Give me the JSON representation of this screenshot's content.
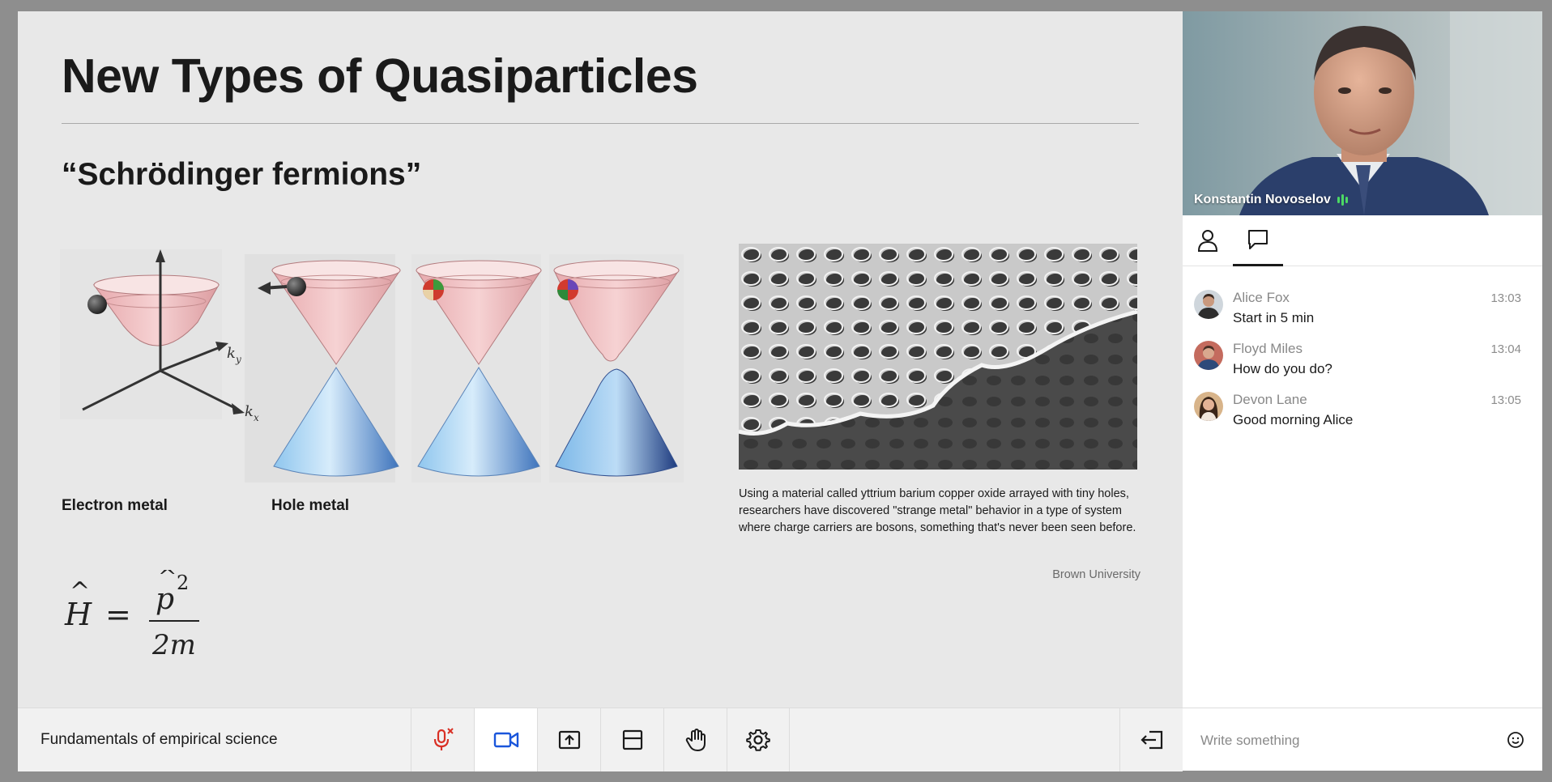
{
  "slide": {
    "title": "New Types of Quasiparticles",
    "subtitle": "“Schrödinger fermions”",
    "captions": {
      "electron_metal": "Electron metal",
      "hole_metal": "Hole metal"
    },
    "axis_labels": {
      "ky": "k",
      "ky_sub": "y",
      "kx": "k",
      "kx_sub": "x"
    },
    "equation": {
      "lhs": "H",
      "eq": "=",
      "numerator": "p",
      "exponent": "2",
      "denominator": "2m"
    },
    "photo_caption": "Using a material called yttrium barium copper oxide arrayed with tiny holes, researchers have discovered \"strange metal\" behavior in a type of system where charge carriers are bosons, something that's never been seen before.",
    "photo_credit": "Brown University"
  },
  "video": {
    "speaker_name": "Konstantin Novoselov",
    "speaking_indicator_color": "#4cd964"
  },
  "panel": {
    "tabs": [
      {
        "label": "participants",
        "icon": "person-icon",
        "active": false
      },
      {
        "label": "chat",
        "icon": "chat-bubble-icon",
        "active": true
      }
    ],
    "messages": [
      {
        "name": "Alice Fox",
        "time": "13:03",
        "text": "Start in 5 min"
      },
      {
        "name": "Floyd Miles",
        "time": "13:04",
        "text": "How do you do?"
      },
      {
        "name": "Devon Lane",
        "time": "13:05",
        "text": "Good morning Alice"
      }
    ]
  },
  "toolbar": {
    "meeting_title": "Fundamentals of empirical science",
    "buttons": [
      {
        "icon": "mic-muted-icon",
        "color": "#d93025"
      },
      {
        "icon": "video-camera-icon",
        "color": "#1a56db",
        "active": true
      },
      {
        "icon": "share-screen-icon"
      },
      {
        "icon": "layout-icon"
      },
      {
        "icon": "raise-hand-icon"
      },
      {
        "icon": "gear-icon"
      }
    ],
    "leave_icon": "leave-icon"
  },
  "composer": {
    "placeholder": "Write something",
    "emoji_icon": "emoji-icon"
  }
}
